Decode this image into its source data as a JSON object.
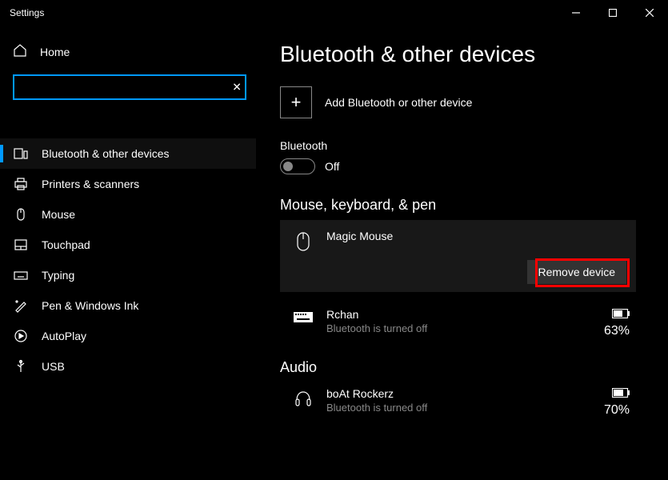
{
  "titlebar": {
    "title": "Settings"
  },
  "sidebar": {
    "home": "Home",
    "search_value": "",
    "items": [
      {
        "label": "Bluetooth & other devices"
      },
      {
        "label": "Printers & scanners"
      },
      {
        "label": "Mouse"
      },
      {
        "label": "Touchpad"
      },
      {
        "label": "Typing"
      },
      {
        "label": "Pen & Windows Ink"
      },
      {
        "label": "AutoPlay"
      },
      {
        "label": "USB"
      }
    ]
  },
  "main": {
    "title": "Bluetooth & other devices",
    "add_label": "Add Bluetooth or other device",
    "bluetooth_label": "Bluetooth",
    "bluetooth_state": "Off",
    "group1": {
      "header": "Mouse, keyboard, & pen",
      "device1": {
        "name": "Magic  Mouse",
        "remove": "Remove device"
      },
      "device2": {
        "name": "Rchan",
        "status": "Bluetooth is turned off",
        "battery": "63%"
      }
    },
    "group2": {
      "header": "Audio",
      "device1": {
        "name": "boAt Rockerz",
        "status": "Bluetooth is turned off",
        "battery": "70%"
      }
    }
  }
}
